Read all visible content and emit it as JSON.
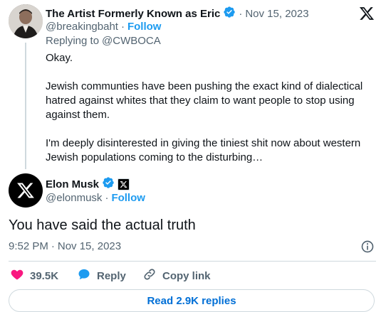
{
  "quoted": {
    "author_name": "The Artist Formerly Known as Eric",
    "handle": "@breakingbaht",
    "follow_label": "Follow",
    "date": "Nov 15, 2023",
    "replying_prefix": "Replying to",
    "replying_to": "@CWBOCA",
    "paragraphs": [
      "Okay.",
      "Jewish communties have been pushing the exact kind of dialectical hatred against whites that they claim to want people to stop using against them.",
      "I'm deeply disinterested in giving the tiniest shit now about western Jewish populations coming to the disturbing…"
    ]
  },
  "main": {
    "author_name": "Elon Musk",
    "handle": "@elonmusk",
    "follow_label": "Follow",
    "text": "You have said the actual truth",
    "time": "9:52 PM",
    "date": "Nov 15, 2023"
  },
  "actions": {
    "likes": "39.5K",
    "reply_label": "Reply",
    "copy_link_label": "Copy link"
  },
  "read_replies_label": "Read 2.9K replies",
  "colors": {
    "link": "#1d9bf0",
    "like": "#f91880",
    "verified": "#1d9bf0",
    "muted": "#536471"
  },
  "icons": [
    "x-logo-icon",
    "verified-badge-icon",
    "x-affiliate-badge-icon",
    "info-icon",
    "heart-icon",
    "reply-bubble-icon",
    "link-icon"
  ]
}
